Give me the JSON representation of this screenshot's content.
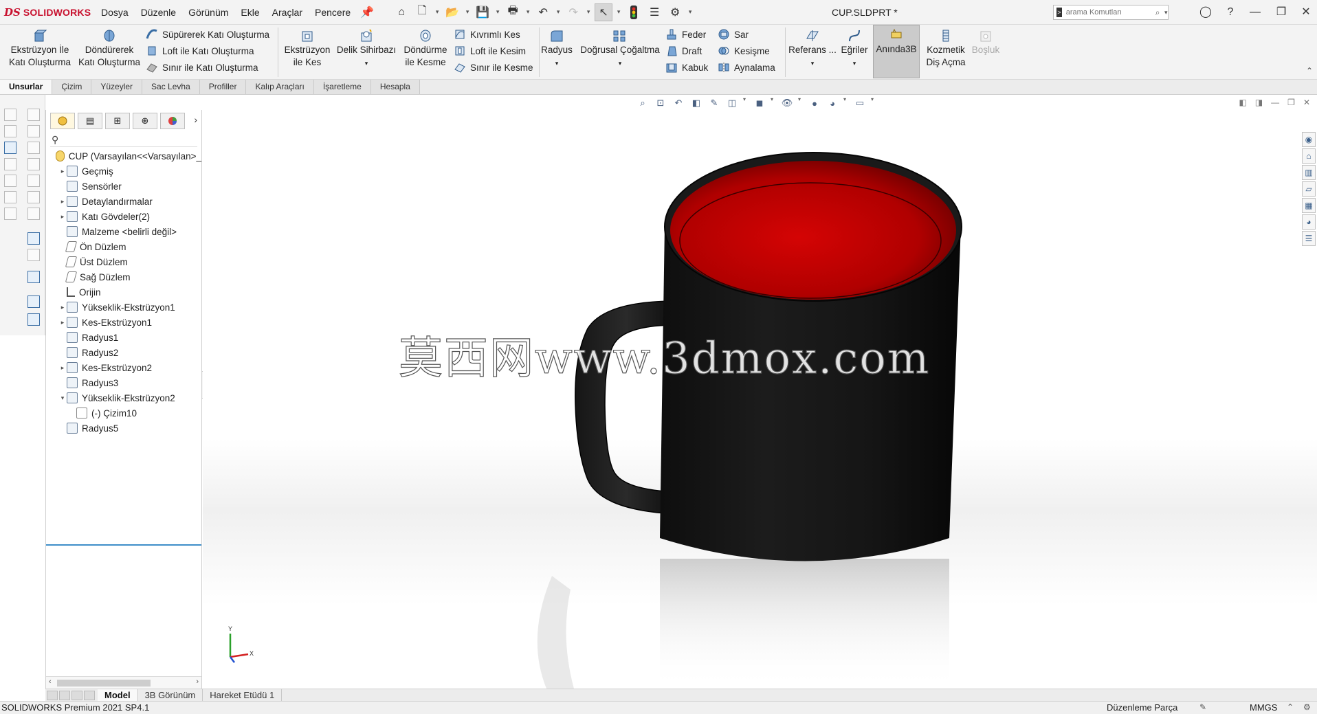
{
  "app": {
    "logo_prefix": "DS",
    "logo_name": "SOLIDWORKS",
    "document_title": "CUP.SLDPRT *"
  },
  "menu": [
    "Dosya",
    "Düzenle",
    "Görünüm",
    "Ekle",
    "Araçlar",
    "Pencere"
  ],
  "search": {
    "placeholder": "arama Komutları"
  },
  "commands": {
    "extrude_boss": "Ekstrüzyon İle\nKatı Oluşturma",
    "extrude_boss_l1": "Ekstrüzyon İle",
    "extrude_boss_l2": "Katı Oluşturma",
    "revolve_boss_l1": "Döndürerek",
    "revolve_boss_l2": "Katı Oluşturma",
    "sweep_boss": "Süpürerek Katı Oluşturma",
    "loft_boss": "Loft ile Katı Oluşturma",
    "boundary_boss": "Sınır ile Katı Oluşturma",
    "extrude_cut_l1": "Ekstrüzyon",
    "extrude_cut_l2": "ile Kes",
    "hole_wizard_l1": "Delik Sihirbazı",
    "revolve_cut_l1": "Döndürme",
    "revolve_cut_l2": "ile Kesme",
    "sweep_cut": "Kıvrımlı Kes",
    "loft_cut": "Loft ile Kesim",
    "boundary_cut": "Sınır ile Kesme",
    "fillet": "Radyus",
    "linear_pattern": "Doğrusal Çoğaltma",
    "rib": "Feder",
    "draft": "Draft",
    "shell": "Kabuk",
    "wrap": "Sar",
    "intersect": "Kesişme",
    "mirror": "Aynalama",
    "reference": "Referans ...",
    "curves": "Eğriler",
    "instant3d": "Anında3B",
    "cosmetic_thread_l1": "Kozmetik",
    "cosmetic_thread_l2": "Diş Açma",
    "void": "Boşluk"
  },
  "tabs": [
    "Unsurlar",
    "Çizim",
    "Yüzeyler",
    "Sac Levha",
    "Profiller",
    "Kalıp Araçları",
    "İşaretleme",
    "Hesapla"
  ],
  "tree": [
    {
      "label": "CUP  (Varsayılan<<Varsayılan>_",
      "expand": "",
      "icon": "root",
      "indent": 0
    },
    {
      "label": "Geçmiş",
      "expand": "▸",
      "icon": "folder",
      "indent": 1
    },
    {
      "label": "Sensörler",
      "expand": "",
      "icon": "folder",
      "indent": 1
    },
    {
      "label": "Detaylandırmalar",
      "expand": "▸",
      "icon": "annot",
      "indent": 1
    },
    {
      "label": "Katı Gövdeler(2)",
      "expand": "▸",
      "icon": "folder",
      "indent": 1
    },
    {
      "label": "Malzeme <belirli değil>",
      "expand": "",
      "icon": "material",
      "indent": 1
    },
    {
      "label": "Ön Düzlem",
      "expand": "",
      "icon": "plane",
      "indent": 1
    },
    {
      "label": "Üst Düzlem",
      "expand": "",
      "icon": "plane",
      "indent": 1
    },
    {
      "label": "Sağ Düzlem",
      "expand": "",
      "icon": "plane",
      "indent": 1
    },
    {
      "label": "Orijin",
      "expand": "",
      "icon": "origin",
      "indent": 1
    },
    {
      "label": "Yükseklik-Ekstrüzyon1",
      "expand": "▸",
      "icon": "feature",
      "indent": 1
    },
    {
      "label": "Kes-Ekstrüzyon1",
      "expand": "▸",
      "icon": "feature",
      "indent": 1
    },
    {
      "label": "Radyus1",
      "expand": "",
      "icon": "feature",
      "indent": 1
    },
    {
      "label": "Radyus2",
      "expand": "",
      "icon": "feature",
      "indent": 1
    },
    {
      "label": "Kes-Ekstrüzyon2",
      "expand": "▸",
      "icon": "feature",
      "indent": 1
    },
    {
      "label": "Radyus3",
      "expand": "",
      "icon": "feature",
      "indent": 1
    },
    {
      "label": "Yükseklik-Ekstrüzyon2",
      "expand": "▾",
      "icon": "feature",
      "indent": 1
    },
    {
      "label": "(-) Çizim10",
      "expand": "",
      "icon": "sketch",
      "indent": 2
    },
    {
      "label": "Radyus5",
      "expand": "",
      "icon": "feature",
      "indent": 1
    }
  ],
  "watermark": "莫西网www.3dmox.com",
  "triad": {
    "x_label": "X",
    "y_label": "Y"
  },
  "bottom_tabs": [
    "Model",
    "3B Görünüm",
    "Hareket Etüdü 1"
  ],
  "status": {
    "product": "SOLIDWORKS Premium 2021 SP4.1",
    "mode": "Düzenleme Parça",
    "units": "MMGS"
  },
  "colors": {
    "mug_body": "#1a1a1a",
    "mug_interior": "#c40000",
    "accent": "#3d8ec9",
    "logo_red": "#c8102e"
  }
}
